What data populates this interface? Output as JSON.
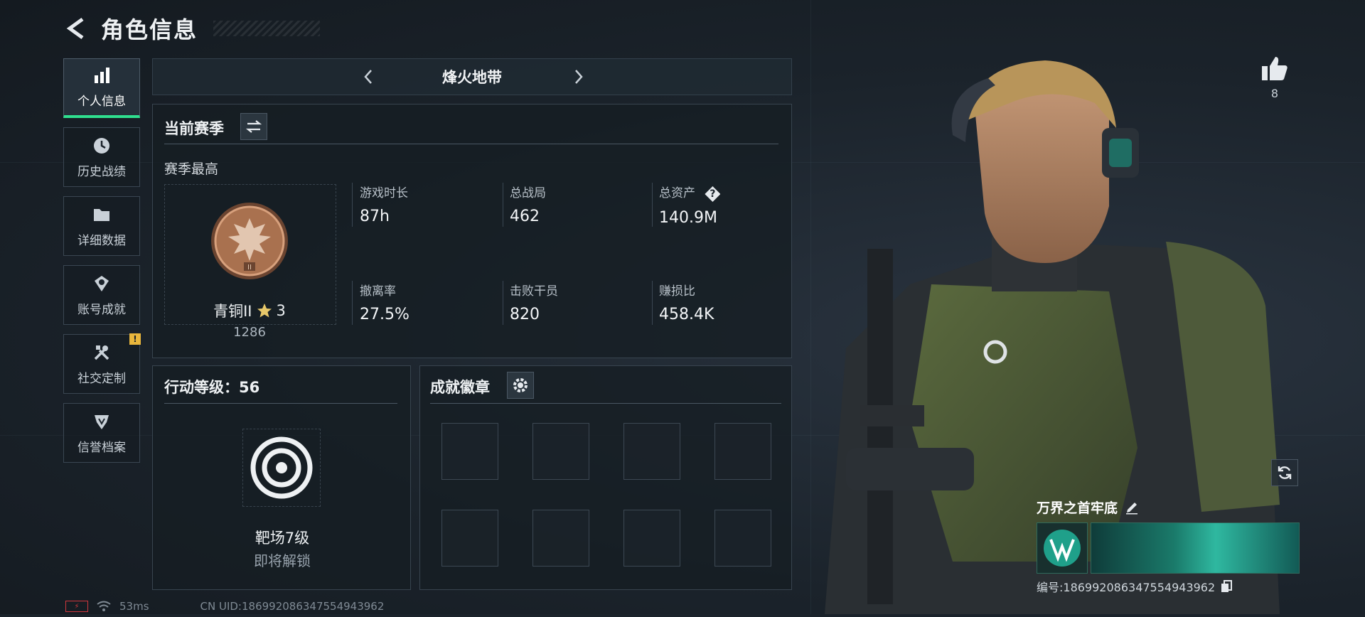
{
  "header": {
    "title": "角色信息"
  },
  "sidebar": {
    "items": [
      {
        "label": "个人信息",
        "icon": "bar-chart-icon",
        "active": true
      },
      {
        "label": "历史战绩",
        "icon": "clock-icon"
      },
      {
        "label": "详细数据",
        "icon": "folder-icon"
      },
      {
        "label": "账号成就",
        "icon": "medal-icon"
      },
      {
        "label": "社交定制",
        "icon": "tools-icon",
        "badge": "!"
      },
      {
        "label": "信誉档案",
        "icon": "shield-icon"
      }
    ]
  },
  "mode": {
    "name": "烽火地带"
  },
  "season": {
    "title": "当前赛季",
    "best_label": "赛季最高",
    "rank_name": "青铜II",
    "rank_stars": "3",
    "rank_points": "1286",
    "stats": [
      {
        "label": "游戏时长",
        "value": "87h"
      },
      {
        "label": "总战局",
        "value": "462"
      },
      {
        "label": "总资产",
        "value": "140.9M",
        "help": "?"
      },
      {
        "label": "撤离率",
        "value": "27.5%"
      },
      {
        "label": "击败干员",
        "value": "820"
      },
      {
        "label": "赚损比",
        "value": "458.4K"
      }
    ]
  },
  "action_level": {
    "title": "行动等级：56",
    "unlock_name": "靶场7级",
    "unlock_status": "即将解锁"
  },
  "achievements": {
    "title": "成就徽章",
    "slots": 8
  },
  "profile": {
    "likes": "8",
    "player_name": "万界之首牢底",
    "player_id": "编号:18699208634755494396​2"
  },
  "status_bar": {
    "ping": "53ms",
    "uid": "CN UID:186992086347554943962"
  },
  "colors": {
    "accent": "#2fe08f",
    "rank_bronze": "#a9714f",
    "badge_yellow": "#e9b63c"
  }
}
